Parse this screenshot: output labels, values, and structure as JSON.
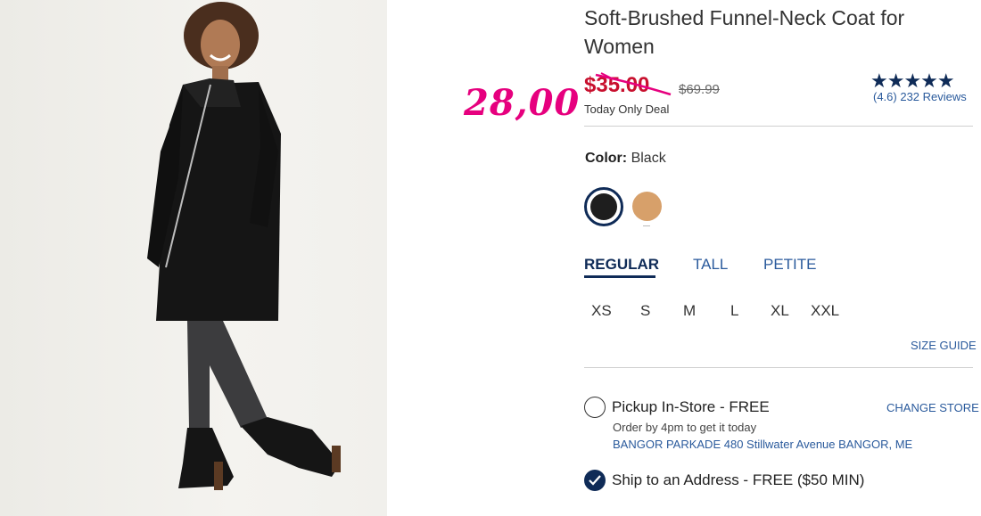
{
  "product": {
    "title": "Soft-Brushed Funnel-Neck Coat for Women",
    "photo_alt": "woman wearing black funnel-neck coat"
  },
  "annotation": {
    "handwritten_price": "28,00",
    "color": "#e6007e"
  },
  "pricing": {
    "current_price": "$35.00",
    "original_price": "$69.99",
    "deal_label": "Today Only Deal"
  },
  "rating": {
    "stars": "★★★★★",
    "value": 4.6,
    "summary": "(4.6) 232 Reviews"
  },
  "color": {
    "label": "Color:",
    "selected": "Black",
    "swatches": [
      {
        "name": "Black",
        "hex": "#1e1e1e",
        "selected": true
      },
      {
        "name": "Tan",
        "hex": "#d7a06a",
        "selected": false
      }
    ]
  },
  "fit_tabs": [
    {
      "label": "REGULAR",
      "active": true
    },
    {
      "label": "TALL",
      "active": false
    },
    {
      "label": "PETITE",
      "active": false
    }
  ],
  "sizes": [
    "XS",
    "S",
    "M",
    "L",
    "XL",
    "XXL"
  ],
  "size_guide_label": "SIZE GUIDE",
  "fulfillment": {
    "pickup": {
      "label": "Pickup In-Store - FREE",
      "note": "Order by 4pm to get it today",
      "store": "BANGOR PARKADE 480 Stillwater Avenue  BANGOR, ME",
      "change_label": "CHANGE STORE",
      "selected": false
    },
    "ship": {
      "label": "Ship to an Address - FREE ($50 MIN)",
      "selected": true
    }
  },
  "colors": {
    "sale_red": "#c8102e",
    "navy": "#0f2b57",
    "link_blue": "#2a5a9c"
  }
}
